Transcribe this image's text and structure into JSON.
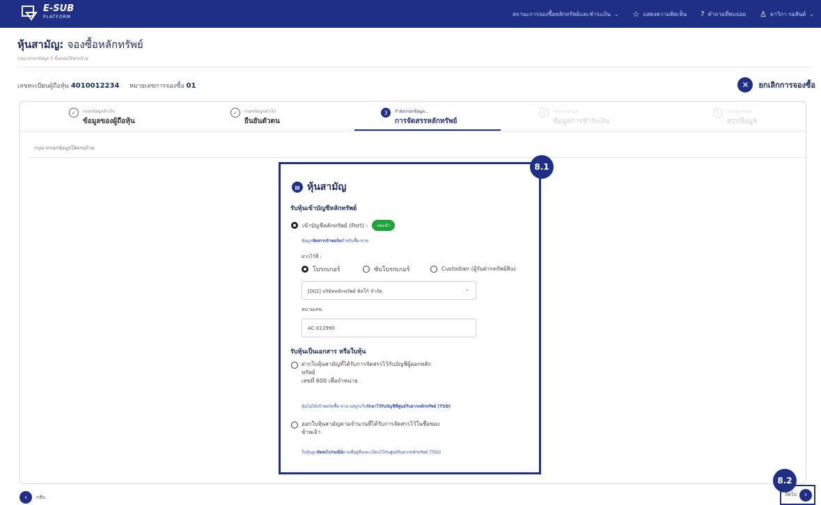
{
  "topbar": {
    "logo_text": "E-SUB",
    "logo_sub": "PLATFORM",
    "nav": [
      {
        "label": "สถานะการจองซื้อหลักทรัพย์และชำระเงิน",
        "icon": "chevron-down-icon"
      },
      {
        "label": "แสดงความคิดเห็น",
        "icon": "star-icon"
      },
      {
        "label": "คำถามที่พบบ่อย",
        "icon": "help-icon"
      },
      {
        "label": "ดาวิกา กอสันต์",
        "icon": "user-icon"
      }
    ]
  },
  "page": {
    "title_bold": "หุ้นสามัญ:",
    "title_light": "จองซื้อหลักทรัพย์",
    "subtitle": "กรุณากรอกข้อมูล 5 ขั้นตอนให้ครบถ้วน"
  },
  "info": {
    "holder_label": "เลขทะเบียนผู้ถือหุ้น",
    "holder_value": "4010012234",
    "order_label": "หมายเลขการจองซื้อ",
    "order_value": "01"
  },
  "cancel_label": "ยกเลิกการจองซื้อ",
  "steps": [
    {
      "small": "กรอกข้อมูลสำเร็จ",
      "big": "ข้อมูลของผู้ถือหุ้น",
      "mark": "✓"
    },
    {
      "small": "กรอกข้อมูลสำเร็จ",
      "big": "ยืนยันตัวตน",
      "mark": "✓"
    },
    {
      "small": "กำลังกรอกข้อมูล...",
      "big": "การจัดสรรหลักทรัพย์",
      "mark": "3"
    },
    {
      "small": "รอกรอกข้อมูล",
      "big": "ข้อมูลการชำระเงิน",
      "mark": "4"
    },
    {
      "small": "รอกรอกข้อมูล",
      "big": "สรุปข้อมูล",
      "mark": "5"
    }
  ],
  "note": "กรุณากรอกข้อมูลให้ครบถ้วน",
  "badges": {
    "panel": "8.1",
    "next": "8.2"
  },
  "panel": {
    "title": "หุ้นสามัญ",
    "section1": "รับหุ้นเข้าบัญชีหลักทรัพย์",
    "port_option": "เข้าบัญชีหลักทรัพย์ (Port) :",
    "port_pill": "แนะนำ",
    "port_link_pre": "หุ้นถูก",
    "port_link_bold": "จัดสรรเข้าพอร์ต",
    "port_link_post": "สำหรับซื้อ-ขาย",
    "deposit_label": "ฝากไว้ที่ :",
    "deposit_options": [
      "โบรกเกอร์",
      "ซับโบรกเกอร์",
      "Custodian (ผู้รับฝากทรัพย์สิน)"
    ],
    "broker_select": "[002] บริษัทหลักทรัพย์ ทิสโก้ จำกัด",
    "account_label": "หมายเลข:",
    "account_value": "AC-012990",
    "section2": "รับหุ้นเป็นเอกสาร หรือใบหุ้น",
    "opt1_line1": "ฝากใบหุ้นสามัญที่ได้รับการจัดสรรไว้กับบัญชีผู้ออกหลัก",
    "opt1_line2": "ทรัพย์",
    "opt1_line3": "เลขที่ 600 เพื่อจำหน่าย",
    "opt1_link_pre": "หุ้นไม่ได้เข้าพอร์ตซื้อ-ขาย แต่ถูกเก็บ",
    "opt1_link_bold": "รักษาไว้กับบัญชีที่ศูนย์รับฝากหลักทรัพย์ (TSD)",
    "opt2_line1": "ออกใบหุ้นสามัญตามจำนวนที่ได้รับการจัดสรรไว้ในชื่อของ",
    "opt2_line2": "ข้าพเจ้า",
    "opt2_link_pre": "ใบหุ้นถูก",
    "opt2_link_bold": "จัดส่งไปรษณีย์",
    "opt2_link_post": "ตามที่อยู่ที่ลงทะเบียนไว้กับศูนย์รับฝากหลักทรัพย์ (TSD)"
  },
  "footer": {
    "back": "กลับ",
    "next": "ถัดไป"
  },
  "colors": {
    "primary": "#1f2f86",
    "accent": "#23a23b"
  }
}
